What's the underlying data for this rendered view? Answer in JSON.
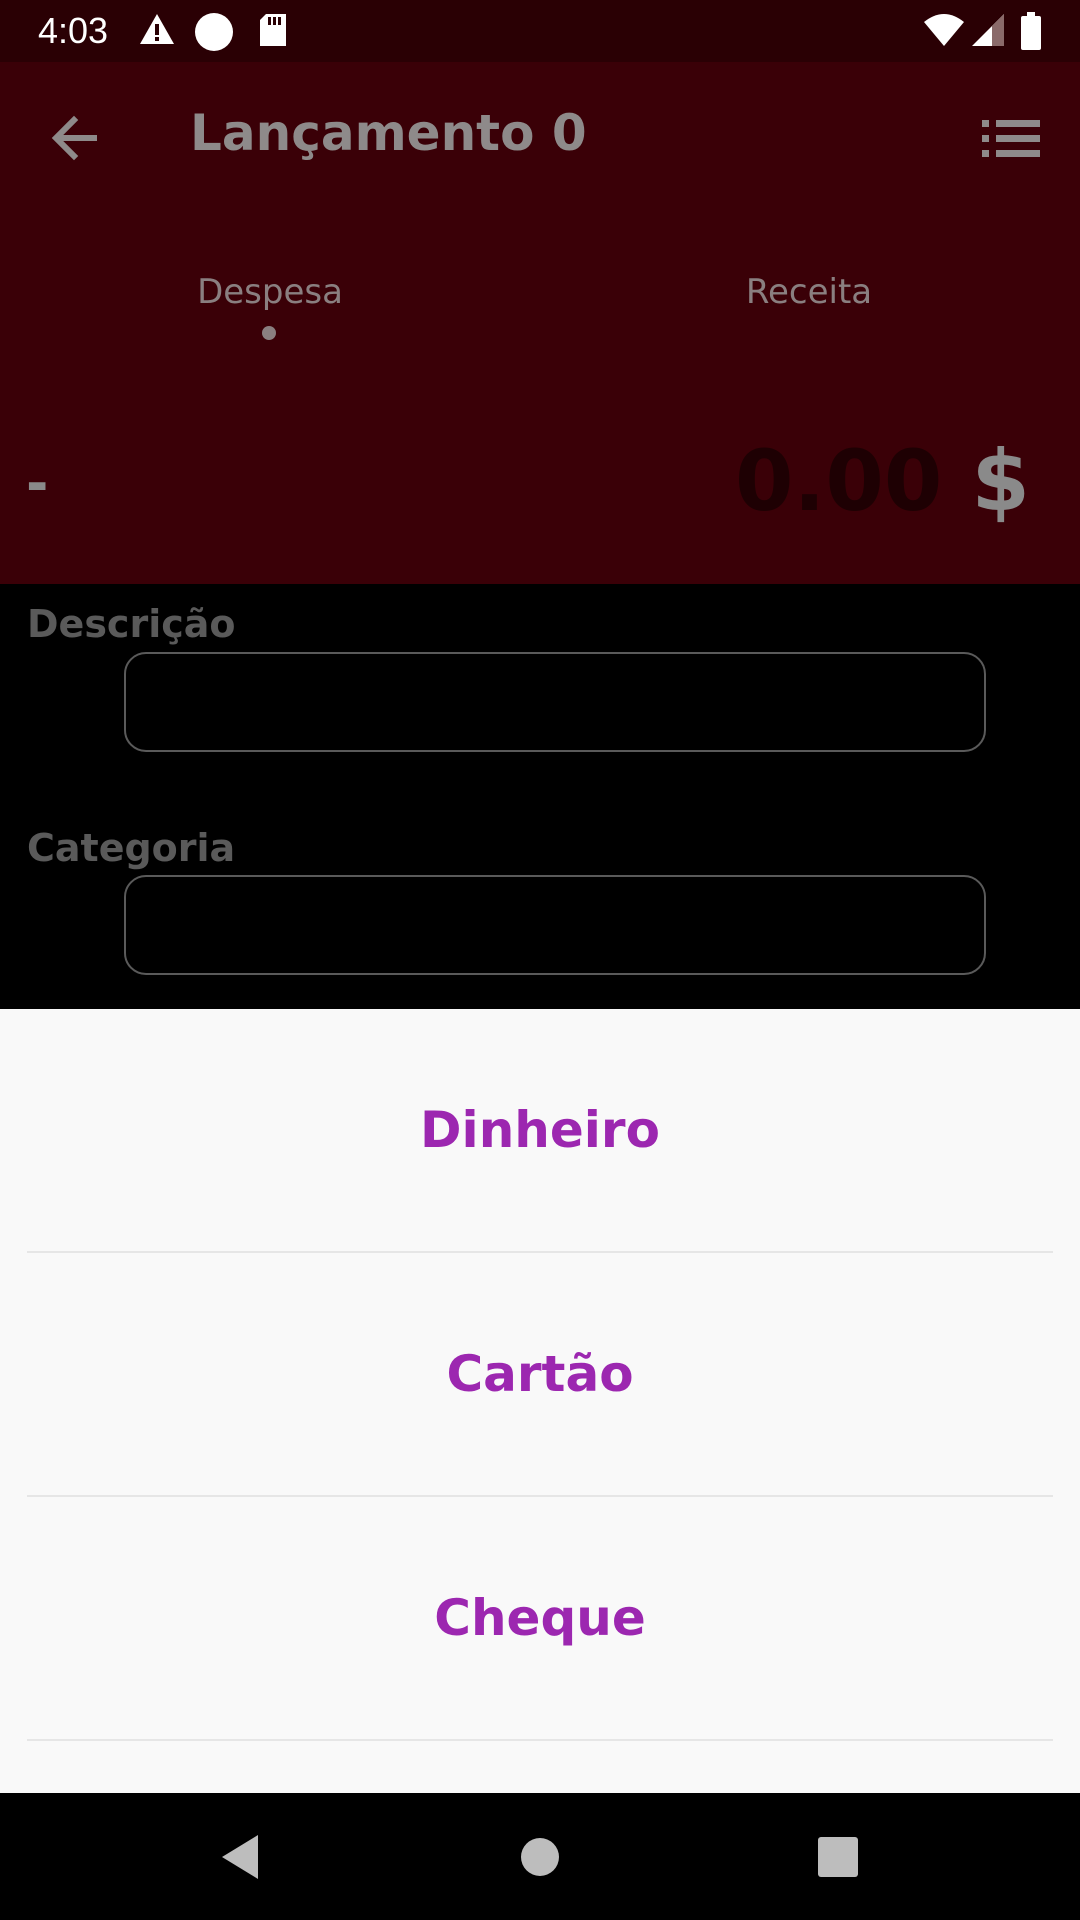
{
  "status_bar": {
    "time": "4:03",
    "icons_left": [
      "alert-icon",
      "circle-icon",
      "sd-card-icon"
    ],
    "icons_right": [
      "wifi-icon",
      "signal-icon",
      "battery-icon"
    ]
  },
  "app_bar": {
    "title": "Lançamento 0",
    "back_icon": "arrow-back-icon",
    "menu_icon": "list-icon"
  },
  "tabs": [
    {
      "label": "Despesa",
      "selected": true
    },
    {
      "label": "Receita",
      "selected": false
    }
  ],
  "amount": {
    "sign": "-",
    "value": "0.00",
    "currency": "$"
  },
  "form": {
    "description_label": "Descrição",
    "category_label": "Categoria"
  },
  "payment_options": [
    "Dinheiro",
    "Cartão",
    "Cheque"
  ],
  "nav_bar": [
    "back-triangle-icon",
    "home-circle-icon",
    "recents-square-icon"
  ],
  "colors": {
    "app_bar_bg": "#3a0007",
    "option_text": "#9c27b0",
    "sheet_bg": "#f9f9f9"
  }
}
